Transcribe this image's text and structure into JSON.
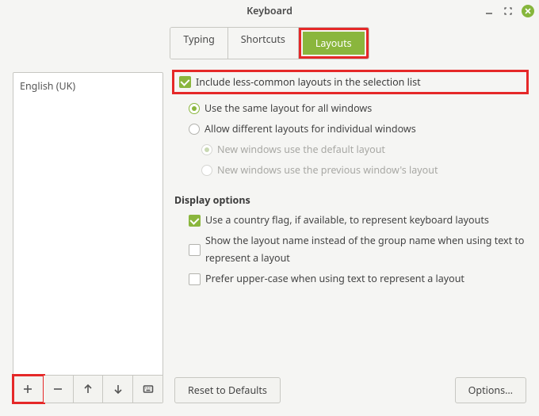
{
  "title": "Keyboard",
  "tabs": {
    "typing": "Typing",
    "shortcuts": "Shortcuts",
    "layouts": "Layouts"
  },
  "active_tab": "layouts",
  "layouts_list": [
    {
      "label": "English (UK)"
    }
  ],
  "options": {
    "include_less_common": {
      "label": "Include less-common layouts in the selection list",
      "checked": true
    },
    "same_layout": {
      "label": "Use the same layout for all windows",
      "selected": true
    },
    "diff_layout": {
      "label": "Allow different layouts for individual windows",
      "selected": false
    },
    "new_default": {
      "label": "New windows use the default layout",
      "selected": true,
      "enabled": false
    },
    "new_previous": {
      "label": "New windows use the previous window's layout",
      "selected": false,
      "enabled": false
    }
  },
  "display_section_title": "Display options",
  "display": {
    "use_flag": {
      "label": "Use a country flag, if available,  to represent keyboard layouts",
      "checked": true
    },
    "show_name": {
      "label": "Show the layout name instead of the group name when using text to represent a layout",
      "checked": false
    },
    "prefer_upper": {
      "label": "Prefer upper-case when using text to represent a layout",
      "checked": false
    }
  },
  "buttons": {
    "reset": "Reset to Defaults",
    "options": "Options…"
  }
}
